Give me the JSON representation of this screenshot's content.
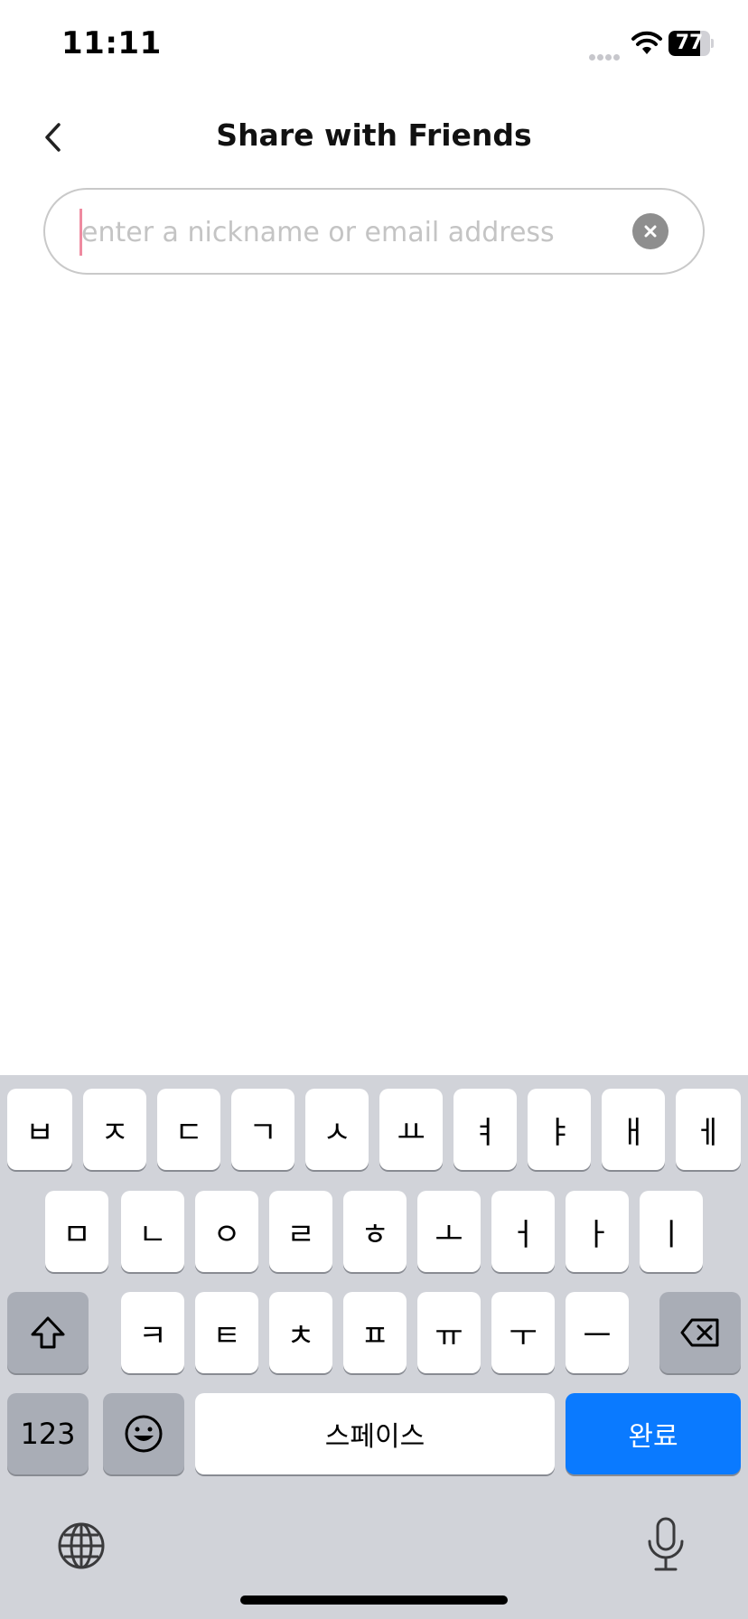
{
  "status": {
    "time": "11:11",
    "battery": "77",
    "battery_level": 0.77
  },
  "nav": {
    "title": "Share with Friends",
    "back_icon": "chevron-left-icon"
  },
  "search": {
    "value": "",
    "placeholder": "enter a nickname or email address",
    "clear_icon": "clear-x-icon"
  },
  "keyboard": {
    "row1": [
      "ㅂ",
      "ㅈ",
      "ㄷ",
      "ㄱ",
      "ㅅ",
      "ㅛ",
      "ㅕ",
      "ㅑ",
      "ㅐ",
      "ㅔ"
    ],
    "row2": [
      "ㅁ",
      "ㄴ",
      "ㅇ",
      "ㄹ",
      "ㅎ",
      "ㅗ",
      "ㅓ",
      "ㅏ",
      "ㅣ"
    ],
    "row3": [
      "ㅋ",
      "ㅌ",
      "ㅊ",
      "ㅍ",
      "ㅠ",
      "ㅜ",
      "ㅡ"
    ],
    "numbers_label": "123",
    "space_label": "스페이스",
    "done_label": "완료",
    "colors": {
      "accent": "#0a7aff",
      "background": "#d1d3d9"
    }
  }
}
